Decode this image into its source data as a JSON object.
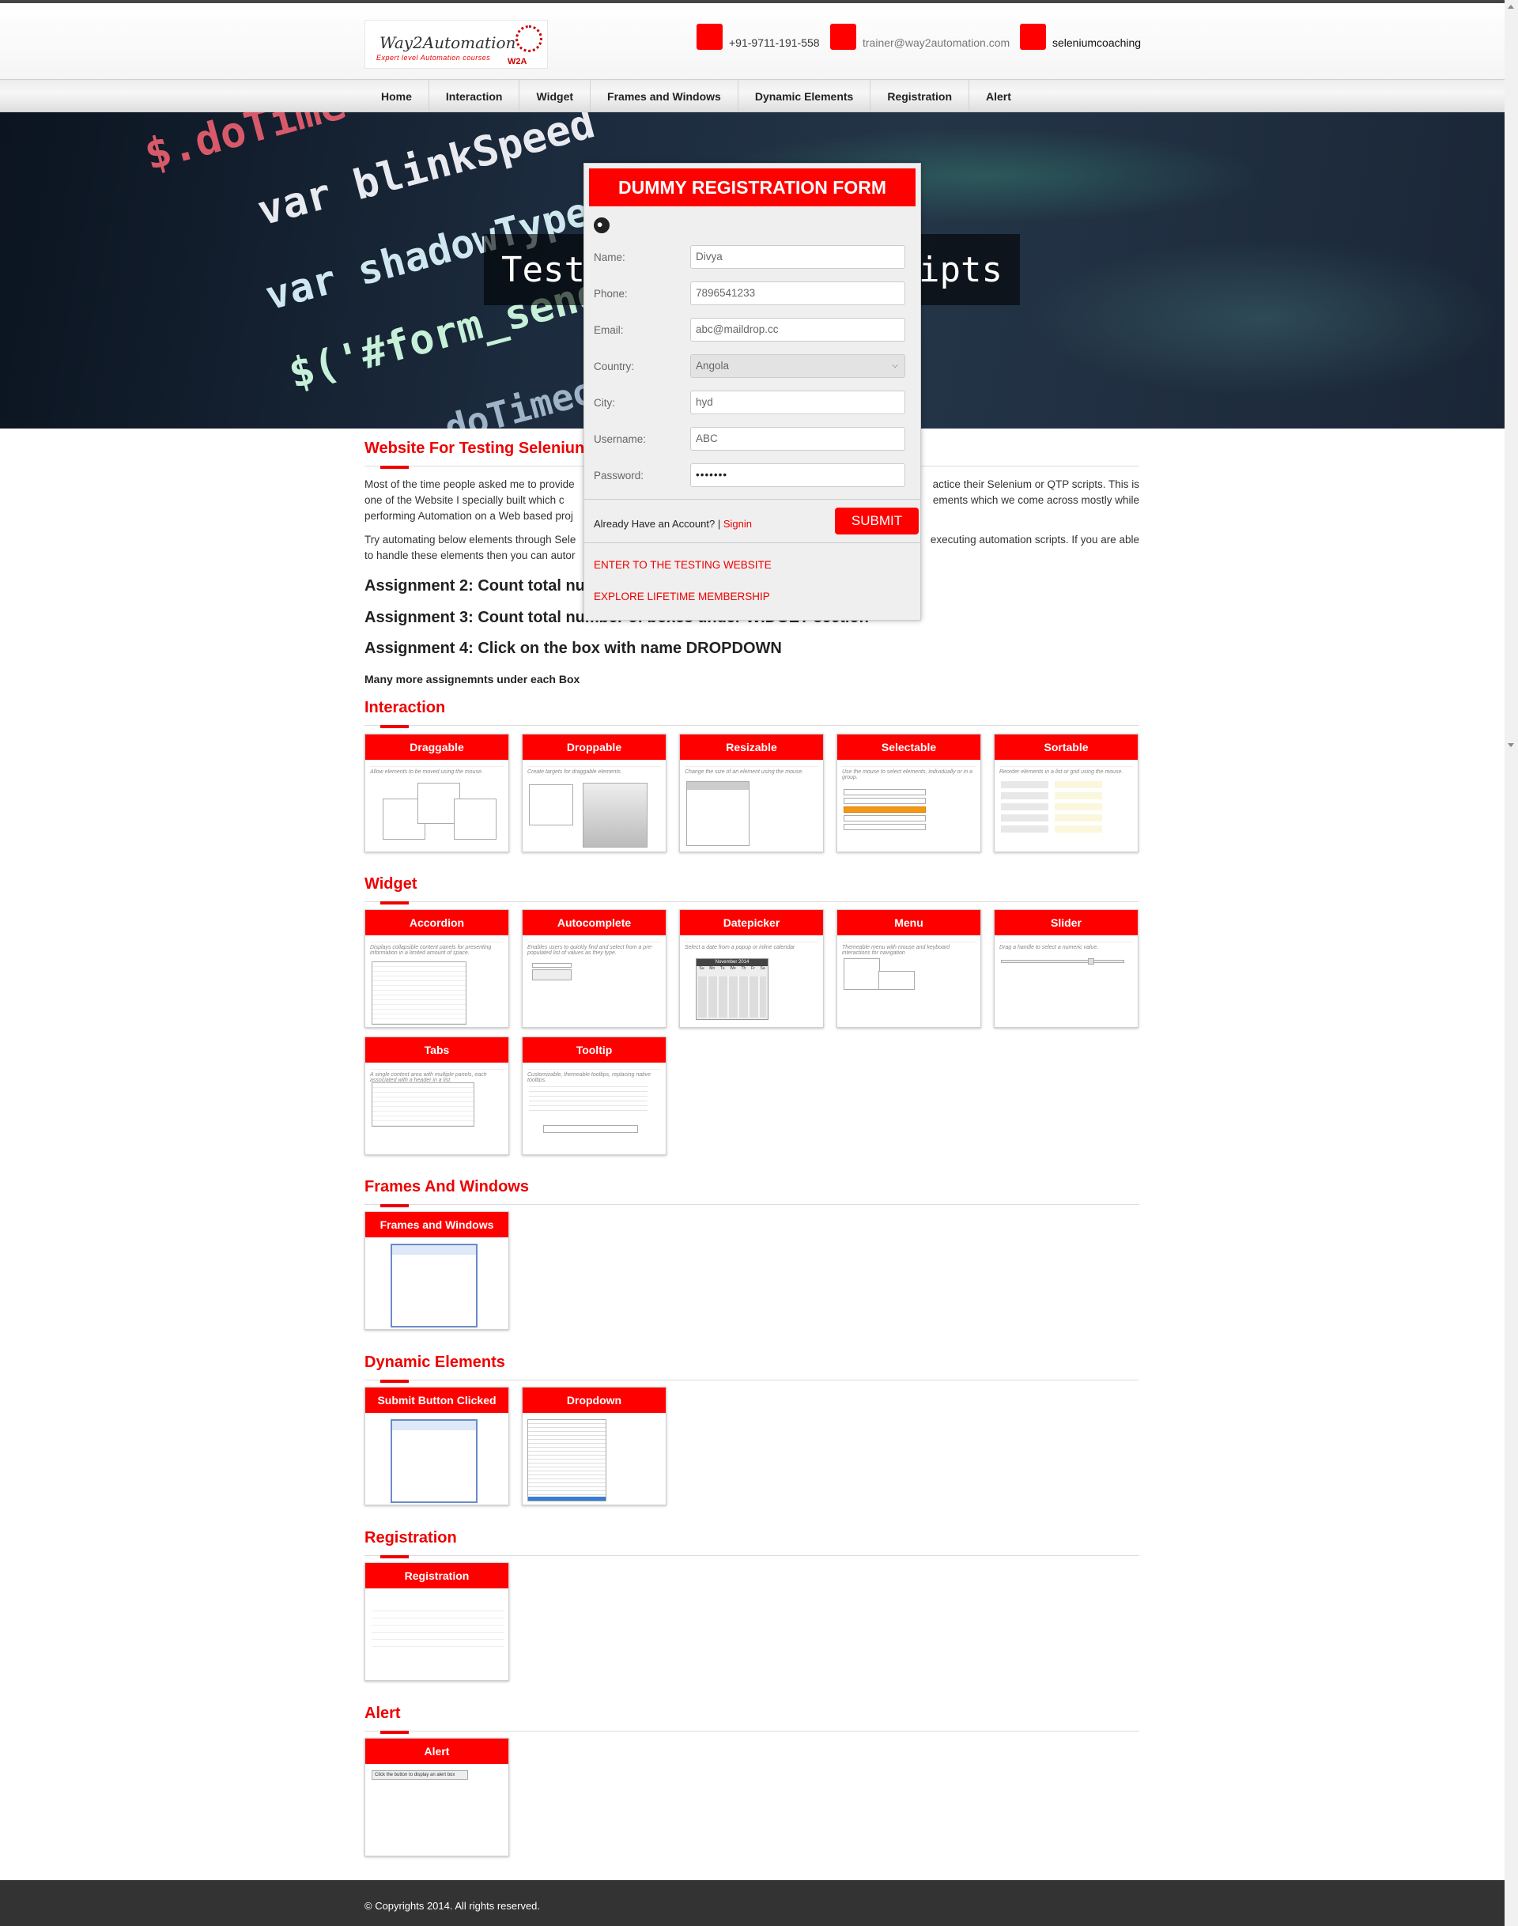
{
  "header": {
    "logo_title": "Way2Automation",
    "logo_tagline": "Expert level Automation courses",
    "logo_badge": "W2A",
    "phone": "+91-9711-191-558",
    "email": "trainer@way2automation.com",
    "skype": "seleniumcoaching"
  },
  "nav": {
    "items": [
      "Home",
      "Interaction",
      "Widget",
      "Frames and Windows",
      "Dynamic Elements",
      "Registration",
      "Alert"
    ]
  },
  "banner": {
    "code_lines": [
      "$.doTime",
      "var blinkSpeed",
      "var shadowType",
      "$('#form_send",
      "doTimeou"
    ],
    "caption_left": "Test",
    "caption_right": "cripts"
  },
  "intro": {
    "title": "Website For Testing Seleniun",
    "p1_left": "Most of the time people asked me to provide",
    "p1_right": "actice their Selenium or QTP scripts. This is",
    "p1_line2_left": "one of the Website I specially built which c",
    "p1_line2_right": "ements which we come across mostly while",
    "p1_line3": "performing Automation on a Web based proj",
    "p2_left": "Try automating below elements through Sele",
    "p2_right": "executing automation scripts. If you are able",
    "p2_line2": "to handle these elements then you can autor",
    "assign2": "Assignment 2: Count total nur",
    "assign3": "Assignment 3: Count total number of boxes under WIDGET section",
    "assign4": "Assignment 4: Click on the box with name DROPDOWN",
    "more": "Many more assignemnts under each Box"
  },
  "sections": {
    "interaction": {
      "title": "Interaction",
      "cards": [
        {
          "label": "Draggable",
          "caption": "Allow elements to be moved using the mouse."
        },
        {
          "label": "Droppable",
          "caption": "Create targets for draggable elements."
        },
        {
          "label": "Resizable",
          "caption": "Change the size of an element using the mouse."
        },
        {
          "label": "Selectable",
          "caption": "Use the mouse to select elements, individually or in a group."
        },
        {
          "label": "Sortable",
          "caption": "Reorder elements in a list or grid using the mouse."
        }
      ]
    },
    "widget": {
      "title": "Widget",
      "cards": [
        {
          "label": "Accordion",
          "caption": "Displays collapsible content panels for presenting information in a limited amount of space."
        },
        {
          "label": "Autocomplete",
          "caption": "Enables users to quickly find and select from a pre-populated list of values as they type."
        },
        {
          "label": "Datepicker",
          "caption": "Select a date from a popup or inline calendar"
        },
        {
          "label": "Menu",
          "caption": "Themeable menu with mouse and keyboard interactions for navigation"
        },
        {
          "label": "Slider",
          "caption": "Drag a handle to select a numeric value."
        },
        {
          "label": "Tabs",
          "caption": "A single content area with multiple panels, each associated with a header in a list."
        },
        {
          "label": "Tooltip",
          "caption": "Customizable, themeable tooltips, replacing native tooltips."
        }
      ],
      "datepicker_month": "November 2014",
      "datepicker_days": [
        "Su",
        "Mo",
        "Tu",
        "We",
        "Th",
        "Fr",
        "Sa"
      ]
    },
    "frames": {
      "title": "Frames And Windows",
      "cards": [
        {
          "label": "Frames and Windows"
        }
      ]
    },
    "dynamic": {
      "title": "Dynamic Elements",
      "cards": [
        {
          "label": "Submit Button Clicked"
        },
        {
          "label": "Dropdown"
        }
      ]
    },
    "registration": {
      "title": "Registration",
      "cards": [
        {
          "label": "Registration"
        }
      ]
    },
    "alert": {
      "title": "Alert",
      "cards": [
        {
          "label": "Alert"
        }
      ],
      "button": "Click the button to display an alert box"
    }
  },
  "modal": {
    "title": "DUMMY REGISTRATION FORM",
    "fields": [
      {
        "label": "Name:",
        "value": "Divya"
      },
      {
        "label": "Phone:",
        "value": "7896541233"
      },
      {
        "label": "Email:",
        "value": "abc@maildrop.cc"
      },
      {
        "label": "Country:",
        "value": "Angola"
      },
      {
        "label": "City:",
        "value": "hyd"
      },
      {
        "label": "Username:",
        "value": "ABC"
      },
      {
        "label": "Password:",
        "value": "•••••••"
      }
    ],
    "already": "Already Have an Account? |",
    "signin": "Signin",
    "submit": "SUBMIT",
    "enter_link": "ENTER TO THE TESTING WEBSITE",
    "membership_link": "EXPLORE LIFETIME MEMBERSHIP"
  },
  "footer": {
    "copyright": "© Copyrights 2014. All rights reserved."
  }
}
